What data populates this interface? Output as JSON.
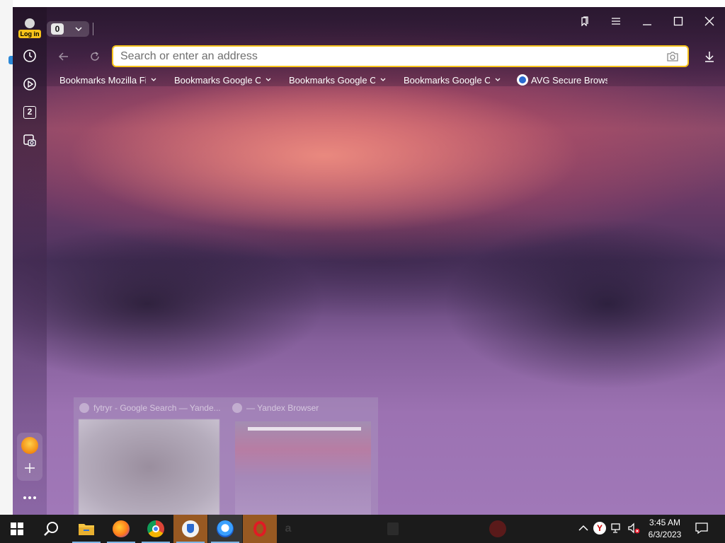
{
  "window": {
    "tab_count": "0",
    "login_label": "Log in",
    "side_counter": "2"
  },
  "addressbar": {
    "placeholder": "Search or enter an address",
    "value": ""
  },
  "bookmarks": [
    {
      "label": "Bookmarks Mozilla Fi",
      "has_menu": true
    },
    {
      "label": "Bookmarks Google C",
      "has_menu": true
    },
    {
      "label": "Bookmarks Google C",
      "has_menu": true
    },
    {
      "label": "Bookmarks Google C",
      "has_menu": true
    },
    {
      "label": "AVG Secure Brows",
      "has_menu": false
    }
  ],
  "thumbnails": [
    {
      "title": "fytryr - Google Search — Yande..."
    },
    {
      "title": "— Yandex Browser"
    }
  ],
  "taskbar": {
    "time": "3:45 AM",
    "date": "6/3/2023",
    "apps": [
      "windows-start",
      "search",
      "file-explorer",
      "firefox",
      "chrome",
      "avg-secure-browser",
      "yandex-browser",
      "opera",
      "amazon",
      "shopping-bag",
      "antivirus"
    ]
  },
  "colors": {
    "accent": "#f7c31b",
    "taskbar": "#1b1b1b",
    "active_indicator": "#7fb6e6"
  }
}
